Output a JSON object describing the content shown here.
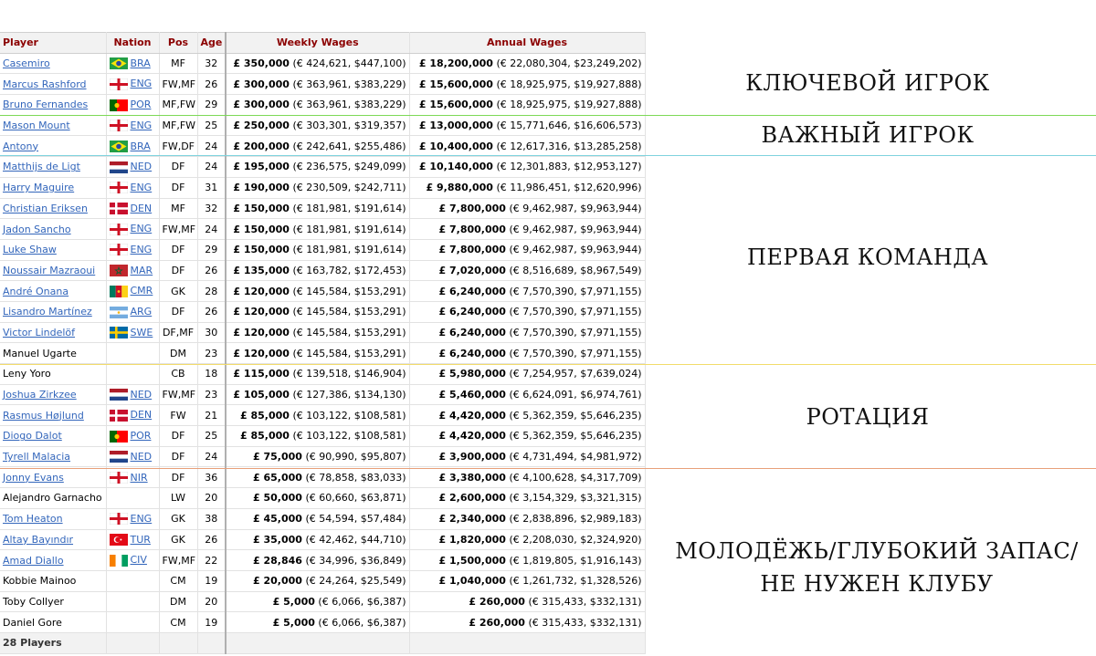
{
  "table": {
    "headers": {
      "player": "Player",
      "nation": "Nation",
      "pos": "Pos",
      "age": "Age",
      "weekly": "Weekly Wages",
      "annual": "Annual Wages"
    },
    "rows": [
      {
        "player": "Casemiro",
        "link": true,
        "nation": "BRA",
        "flag": "bra",
        "pos": "MF",
        "age": "32",
        "weekly_gbp": "£ 350,000",
        "weekly_conv": " (€ 424,621, $447,100)",
        "annual_gbp": "£ 18,200,000",
        "annual_conv": " (€ 22,080,304, $23,249,202)"
      },
      {
        "player": "Marcus Rashford",
        "link": true,
        "nation": "ENG",
        "flag": "eng",
        "pos": "FW,MF",
        "age": "26",
        "weekly_gbp": "£ 300,000",
        "weekly_conv": " (€ 363,961, $383,229)",
        "annual_gbp": "£ 15,600,000",
        "annual_conv": " (€ 18,925,975, $19,927,888)"
      },
      {
        "player": "Bruno Fernandes",
        "link": true,
        "nation": "POR",
        "flag": "por",
        "pos": "MF,FW",
        "age": "29",
        "weekly_gbp": "£ 300,000",
        "weekly_conv": " (€ 363,961, $383,229)",
        "annual_gbp": "£ 15,600,000",
        "annual_conv": " (€ 18,925,975, $19,927,888)"
      },
      {
        "player": "Mason Mount",
        "link": true,
        "nation": "ENG",
        "flag": "eng",
        "pos": "MF,FW",
        "age": "25",
        "weekly_gbp": "£ 250,000",
        "weekly_conv": " (€ 303,301, $319,357)",
        "annual_gbp": "£ 13,000,000",
        "annual_conv": " (€ 15,771,646, $16,606,573)"
      },
      {
        "player": "Antony",
        "link": true,
        "nation": "BRA",
        "flag": "bra",
        "pos": "FW,DF",
        "age": "24",
        "weekly_gbp": "£ 200,000",
        "weekly_conv": " (€ 242,641, $255,486)",
        "annual_gbp": "£ 10,400,000",
        "annual_conv": " (€ 12,617,316, $13,285,258)"
      },
      {
        "player": "Matthijs de Ligt",
        "link": true,
        "nation": "NED",
        "flag": "ned",
        "pos": "DF",
        "age": "24",
        "weekly_gbp": "£ 195,000",
        "weekly_conv": " (€ 236,575, $249,099)",
        "annual_gbp": "£ 10,140,000",
        "annual_conv": " (€ 12,301,883, $12,953,127)"
      },
      {
        "player": "Harry Maguire",
        "link": true,
        "nation": "ENG",
        "flag": "eng",
        "pos": "DF",
        "age": "31",
        "weekly_gbp": "£ 190,000",
        "weekly_conv": " (€ 230,509, $242,711)",
        "annual_gbp": "£ 9,880,000",
        "annual_conv": " (€ 11,986,451, $12,620,996)"
      },
      {
        "player": "Christian Eriksen",
        "link": true,
        "nation": "DEN",
        "flag": "den",
        "pos": "MF",
        "age": "32",
        "weekly_gbp": "£ 150,000",
        "weekly_conv": " (€ 181,981, $191,614)",
        "annual_gbp": "£ 7,800,000",
        "annual_conv": " (€ 9,462,987, $9,963,944)"
      },
      {
        "player": "Jadon Sancho",
        "link": true,
        "nation": "ENG",
        "flag": "eng",
        "pos": "FW,MF",
        "age": "24",
        "weekly_gbp": "£ 150,000",
        "weekly_conv": " (€ 181,981, $191,614)",
        "annual_gbp": "£ 7,800,000",
        "annual_conv": " (€ 9,462,987, $9,963,944)"
      },
      {
        "player": "Luke Shaw",
        "link": true,
        "nation": "ENG",
        "flag": "eng",
        "pos": "DF",
        "age": "29",
        "weekly_gbp": "£ 150,000",
        "weekly_conv": " (€ 181,981, $191,614)",
        "annual_gbp": "£ 7,800,000",
        "annual_conv": " (€ 9,462,987, $9,963,944)"
      },
      {
        "player": "Noussair Mazraoui",
        "link": true,
        "nation": "MAR",
        "flag": "mar",
        "pos": "DF",
        "age": "26",
        "weekly_gbp": "£ 135,000",
        "weekly_conv": " (€ 163,782, $172,453)",
        "annual_gbp": "£ 7,020,000",
        "annual_conv": " (€ 8,516,689, $8,967,549)"
      },
      {
        "player": "André Onana",
        "link": true,
        "nation": "CMR",
        "flag": "cmr",
        "pos": "GK",
        "age": "28",
        "weekly_gbp": "£ 120,000",
        "weekly_conv": " (€ 145,584, $153,291)",
        "annual_gbp": "£ 6,240,000",
        "annual_conv": " (€ 7,570,390, $7,971,155)"
      },
      {
        "player": "Lisandro Martínez",
        "link": true,
        "nation": "ARG",
        "flag": "arg",
        "pos": "DF",
        "age": "26",
        "weekly_gbp": "£ 120,000",
        "weekly_conv": " (€ 145,584, $153,291)",
        "annual_gbp": "£ 6,240,000",
        "annual_conv": " (€ 7,570,390, $7,971,155)"
      },
      {
        "player": "Victor Lindelöf",
        "link": true,
        "nation": "SWE",
        "flag": "swe",
        "pos": "DF,MF",
        "age": "30",
        "weekly_gbp": "£ 120,000",
        "weekly_conv": " (€ 145,584, $153,291)",
        "annual_gbp": "£ 6,240,000",
        "annual_conv": " (€ 7,570,390, $7,971,155)"
      },
      {
        "player": "Manuel Ugarte",
        "link": false,
        "nation": "",
        "flag": "",
        "pos": "DM",
        "age": "23",
        "weekly_gbp": "£ 120,000",
        "weekly_conv": " (€ 145,584, $153,291)",
        "annual_gbp": "£ 6,240,000",
        "annual_conv": " (€ 7,570,390, $7,971,155)"
      },
      {
        "player": "Leny Yoro",
        "link": false,
        "nation": "",
        "flag": "",
        "pos": "CB",
        "age": "18",
        "weekly_gbp": "£ 115,000",
        "weekly_conv": " (€ 139,518, $146,904)",
        "annual_gbp": "£ 5,980,000",
        "annual_conv": " (€ 7,254,957, $7,639,024)"
      },
      {
        "player": "Joshua Zirkzee",
        "link": true,
        "nation": "NED",
        "flag": "ned",
        "pos": "FW,MF",
        "age": "23",
        "weekly_gbp": "£ 105,000",
        "weekly_conv": " (€ 127,386, $134,130)",
        "annual_gbp": "£ 5,460,000",
        "annual_conv": " (€ 6,624,091, $6,974,761)"
      },
      {
        "player": "Rasmus Højlund",
        "link": true,
        "nation": "DEN",
        "flag": "den",
        "pos": "FW",
        "age": "21",
        "weekly_gbp": "£ 85,000",
        "weekly_conv": " (€ 103,122, $108,581)",
        "annual_gbp": "£ 4,420,000",
        "annual_conv": " (€ 5,362,359, $5,646,235)"
      },
      {
        "player": "Diogo Dalot",
        "link": true,
        "nation": "POR",
        "flag": "por",
        "pos": "DF",
        "age": "25",
        "weekly_gbp": "£ 85,000",
        "weekly_conv": " (€ 103,122, $108,581)",
        "annual_gbp": "£ 4,420,000",
        "annual_conv": " (€ 5,362,359, $5,646,235)"
      },
      {
        "player": "Tyrell Malacia",
        "link": true,
        "nation": "NED",
        "flag": "ned",
        "pos": "DF",
        "age": "24",
        "weekly_gbp": "£ 75,000",
        "weekly_conv": " (€ 90,990, $95,807)",
        "annual_gbp": "£ 3,900,000",
        "annual_conv": " (€ 4,731,494, $4,981,972)"
      },
      {
        "player": "Jonny Evans",
        "link": true,
        "nation": "NIR",
        "flag": "nir",
        "pos": "DF",
        "age": "36",
        "weekly_gbp": "£ 65,000",
        "weekly_conv": " (€ 78,858, $83,033)",
        "annual_gbp": "£ 3,380,000",
        "annual_conv": " (€ 4,100,628, $4,317,709)"
      },
      {
        "player": "Alejandro Garnacho",
        "link": false,
        "nation": "",
        "flag": "",
        "pos": "LW",
        "age": "20",
        "weekly_gbp": "£ 50,000",
        "weekly_conv": " (€ 60,660, $63,871)",
        "annual_gbp": "£ 2,600,000",
        "annual_conv": " (€ 3,154,329, $3,321,315)"
      },
      {
        "player": "Tom Heaton",
        "link": true,
        "nation": "ENG",
        "flag": "eng",
        "pos": "GK",
        "age": "38",
        "weekly_gbp": "£ 45,000",
        "weekly_conv": " (€ 54,594, $57,484)",
        "annual_gbp": "£ 2,340,000",
        "annual_conv": " (€ 2,838,896, $2,989,183)"
      },
      {
        "player": "Altay Bayındır",
        "link": true,
        "nation": "TUR",
        "flag": "tur",
        "pos": "GK",
        "age": "26",
        "weekly_gbp": "£ 35,000",
        "weekly_conv": " (€ 42,462, $44,710)",
        "annual_gbp": "£ 1,820,000",
        "annual_conv": " (€ 2,208,030, $2,324,920)"
      },
      {
        "player": "Amad Diallo",
        "link": true,
        "nation": "CIV",
        "flag": "civ",
        "pos": "FW,MF",
        "age": "22",
        "weekly_gbp": "£ 28,846",
        "weekly_conv": " (€ 34,996, $36,849)",
        "annual_gbp": "£ 1,500,000",
        "annual_conv": " (€ 1,819,805, $1,916,143)"
      },
      {
        "player": "Kobbie Mainoo",
        "link": false,
        "nation": "",
        "flag": "",
        "pos": "CM",
        "age": "19",
        "weekly_gbp": "£ 20,000",
        "weekly_conv": " (€ 24,264, $25,549)",
        "annual_gbp": "£ 1,040,000",
        "annual_conv": " (€ 1,261,732, $1,328,526)"
      },
      {
        "player": "Toby Collyer",
        "link": false,
        "nation": "",
        "flag": "",
        "pos": "DM",
        "age": "20",
        "weekly_gbp": "£ 5,000",
        "weekly_conv": " (€ 6,066, $6,387)",
        "annual_gbp": "£ 260,000",
        "annual_conv": " (€ 315,433, $332,131)"
      },
      {
        "player": "Daniel Gore",
        "link": false,
        "nation": "",
        "flag": "",
        "pos": "CM",
        "age": "19",
        "weekly_gbp": "£ 5,000",
        "weekly_conv": " (€ 6,066, $6,387)",
        "annual_gbp": "£ 260,000",
        "annual_conv": " (€ 315,433, $332,131)"
      }
    ],
    "footer": "28 Players"
  },
  "tiers": [
    {
      "label": "КЛЮЧЕВОЙ ИГРОК",
      "line_color": ""
    },
    {
      "label": "ВАЖНЫЙ ИГРОК",
      "line_color": "#7ed957"
    },
    {
      "label": "ПЕРВАЯ КОМАНДА",
      "line_color": "#7fd3de"
    },
    {
      "label": "РОТАЦИЯ",
      "line_color": "#f2dc6b"
    },
    {
      "label": "МОЛОДЁЖЬ/ГЛУБОКИЙ ЗАПАС/\nНЕ НУЖЕН КЛУБУ",
      "line_color": "#e8a07a"
    }
  ],
  "colors": {
    "header_text": "#8b0000",
    "link": "#3366bb"
  }
}
